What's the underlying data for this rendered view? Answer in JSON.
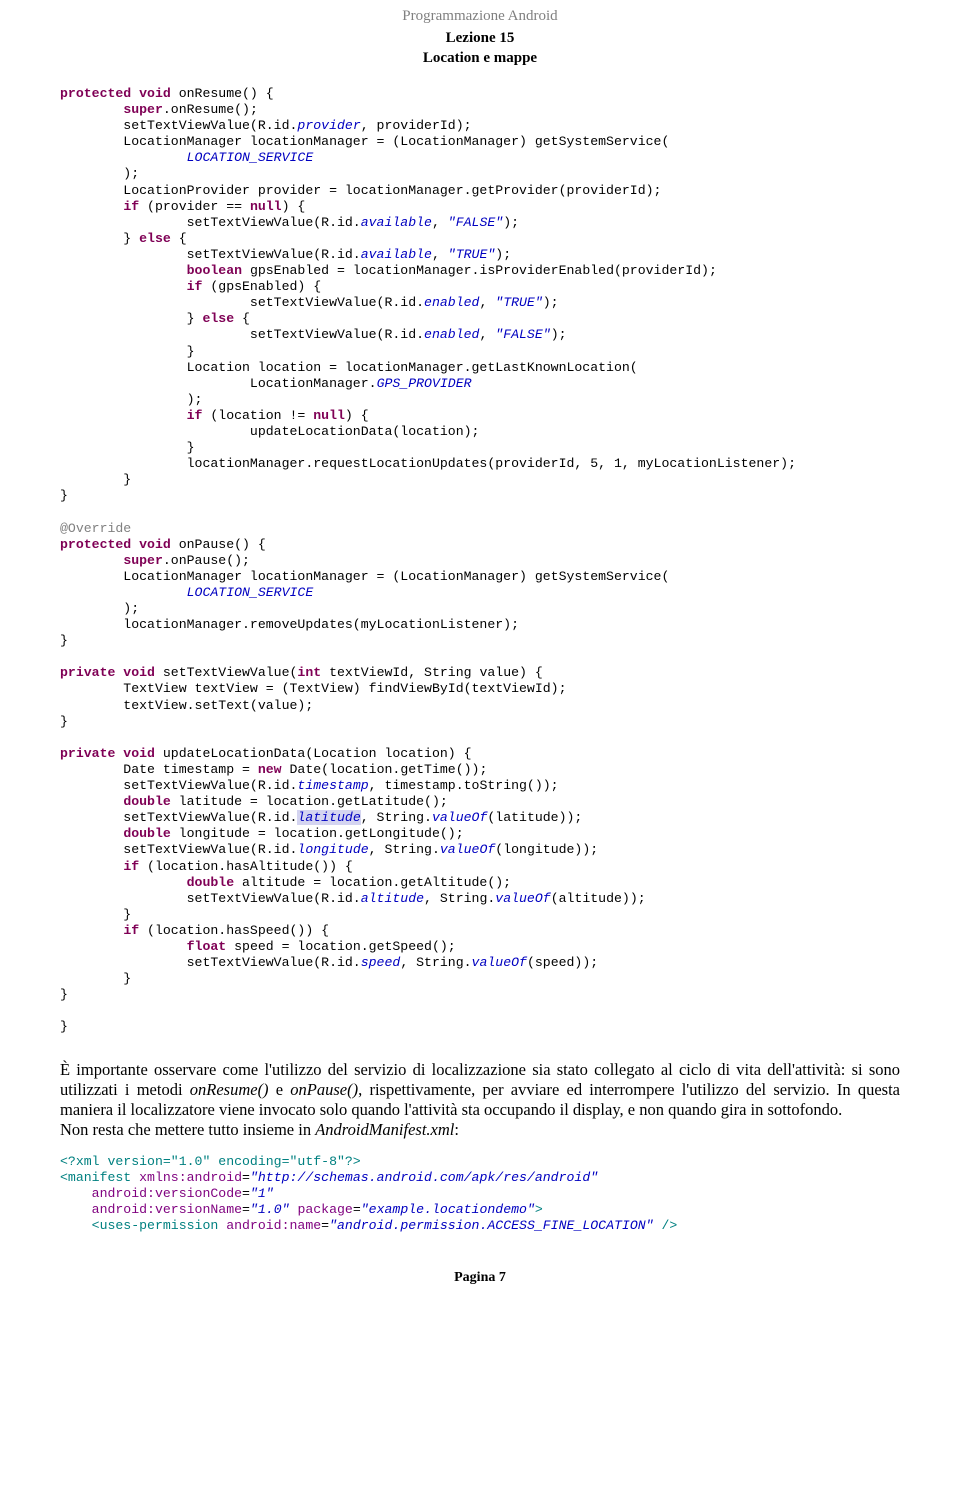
{
  "header": {
    "series": "Programmazione Android"
  },
  "subhead": {
    "line1": "Lezione 15",
    "line2": "Location e mappe"
  },
  "code1": {
    "l01a": "protected void",
    "l01b": " onResume() {",
    "l02a": "        ",
    "l02b": "super",
    "l02c": ".onResume();",
    "l03a": "        setTextViewValue(R.id.",
    "l03b": "provider",
    "l03c": ", providerId);",
    "l04": "        LocationManager locationManager = (LocationManager) getSystemService(",
    "l05a": "                ",
    "l05b": "LOCATION_SERVICE",
    "l06": "        );",
    "l07": "        LocationProvider provider = locationManager.getProvider(providerId);",
    "l08a": "        ",
    "l08b": "if",
    "l08c": " (provider == ",
    "l08d": "null",
    "l08e": ") {",
    "l09a": "                setTextViewValue(R.id.",
    "l09b": "available",
    "l09c": ", ",
    "l09d": "\"FALSE\"",
    "l09e": ");",
    "l10a": "        } ",
    "l10b": "else",
    "l10c": " {",
    "l11a": "                setTextViewValue(R.id.",
    "l11b": "available",
    "l11c": ", ",
    "l11d": "\"TRUE\"",
    "l11e": ");",
    "l12a": "                ",
    "l12b": "boolean",
    "l12c": " gpsEnabled = locationManager.isProviderEnabled(providerId);",
    "l13a": "                ",
    "l13b": "if",
    "l13c": " (gpsEnabled) {",
    "l14a": "                        setTextViewValue(R.id.",
    "l14b": "enabled",
    "l14c": ", ",
    "l14d": "\"TRUE\"",
    "l14e": ");",
    "l15a": "                } ",
    "l15b": "else",
    "l15c": " {",
    "l16a": "                        setTextViewValue(R.id.",
    "l16b": "enabled",
    "l16c": ", ",
    "l16d": "\"FALSE\"",
    "l16e": ");",
    "l17": "                }",
    "l18": "                Location location = locationManager.getLastKnownLocation(",
    "l19a": "                        LocationManager.",
    "l19b": "GPS_PROVIDER",
    "l20": "                );",
    "l21a": "                ",
    "l21b": "if",
    "l21c": " (location != ",
    "l21d": "null",
    "l21e": ") {",
    "l22": "                        updateLocationData(location);",
    "l23": "                }",
    "l24": "                locationManager.requestLocationUpdates(providerId, 5, 1, myLocationListener);",
    "l25": "        }",
    "l26": "}",
    "l27": "",
    "l28": "@Override",
    "l29a": "protected void",
    "l29b": " onPause() {",
    "l30a": "        ",
    "l30b": "super",
    "l30c": ".onPause();",
    "l31": "        LocationManager locationManager = (LocationManager) getSystemService(",
    "l32a": "                ",
    "l32b": "LOCATION_SERVICE",
    "l33": "        );",
    "l34": "        locationManager.removeUpdates(myLocationListener);",
    "l35": "}",
    "l36": "",
    "l37a": "private void",
    "l37b": " setTextViewValue(",
    "l37c": "int",
    "l37d": " textViewId, String value) {",
    "l38": "        TextView textView = (TextView) findViewById(textViewId);",
    "l39": "        textView.setText(value);",
    "l40": "}",
    "l41": "",
    "l42a": "private void",
    "l42b": " updateLocationData(Location location) {",
    "l43a": "        Date timestamp = ",
    "l43b": "new",
    "l43c": " Date(location.getTime());",
    "l44a": "        setTextViewValue(R.id.",
    "l44b": "timestamp",
    "l44c": ", timestamp.toString());",
    "l45a": "        ",
    "l45b": "double",
    "l45c": " latitude = location.getLatitude();",
    "l46a": "        setTextViewValue(R.id.",
    "l46b": "latitude",
    "l46c": ", String.",
    "l46d": "valueOf",
    "l46e": "(latitude));",
    "l47a": "        ",
    "l47b": "double",
    "l47c": " longitude = location.getLongitude();",
    "l48a": "        setTextViewValue(R.id.",
    "l48b": "longitude",
    "l48c": ", String.",
    "l48d": "valueOf",
    "l48e": "(longitude));",
    "l49a": "        ",
    "l49b": "if",
    "l49c": " (location.hasAltitude()) {",
    "l50a": "                ",
    "l50b": "double",
    "l50c": " altitude = location.getAltitude();",
    "l51a": "                setTextViewValue(R.id.",
    "l51b": "altitude",
    "l51c": ", String.",
    "l51d": "valueOf",
    "l51e": "(altitude));",
    "l52": "        }",
    "l53a": "        ",
    "l53b": "if",
    "l53c": " (location.hasSpeed()) {",
    "l54a": "                ",
    "l54b": "float",
    "l54c": " speed = location.getSpeed();",
    "l55a": "                setTextViewValue(R.id.",
    "l55b": "speed",
    "l55c": ", String.",
    "l55d": "valueOf",
    "l55e": "(speed));",
    "l56": "        }",
    "l57": "}",
    "l58": "",
    "l59": "}"
  },
  "paragraph": {
    "t1": "È importante osservare come l'utilizzo del servizio di localizzazione sia stato collegato al ciclo di vita dell'attività: si sono utilizzati i metodi ",
    "i1": "onResume()",
    "t2": " e ",
    "i2": "onPause()",
    "t3": ", rispettivamente, per avviare ed interrompere l'utilizzo del servizio. In questa maniera il localizzatore viene invocato solo quando l'attività sta occupando il display, e non quando gira in sottofondo.",
    "t4": "Non resta che mettere tutto insieme in ",
    "i3": "AndroidManifest.xml",
    "t5": ":"
  },
  "code2": {
    "l01": "<?xml version=\"1.0\" encoding=\"utf-8\"?>",
    "l02a": "<manifest",
    "l02b": " xmlns:android",
    "l02c": "=",
    "l02d": "\"http://schemas.android.com/apk/res/android\"",
    "l03a": "    ",
    "l03b": "android:versionCode",
    "l03c": "=",
    "l03d": "\"1\"",
    "l04a": "    ",
    "l04b": "android:versionName",
    "l04c": "=",
    "l04d": "\"1.0\"",
    "l04e": " package",
    "l04f": "=",
    "l04g": "\"example.locationdemo\"",
    "l04h": ">",
    "l05a": "    ",
    "l05b": "<uses-permission",
    "l05c": " android:name",
    "l05d": "=",
    "l05e": "\"android.permission.ACCESS_FINE_LOCATION\"",
    "l05f": " />"
  },
  "footer": {
    "page": "Pagina 7"
  }
}
